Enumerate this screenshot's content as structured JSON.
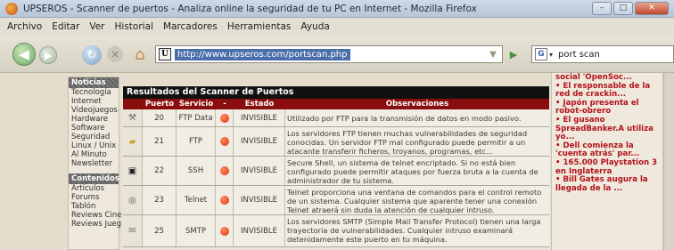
{
  "window": {
    "title": "UPSEROS - Scanner de puertos - Analiza online la seguridad de tu PC en Internet - Mozilla Firefox",
    "controls": [
      "–",
      "□",
      "✕"
    ]
  },
  "menu": [
    "Archivo",
    "Editar",
    "Ver",
    "Historial",
    "Marcadores",
    "Herramientas",
    "Ayuda"
  ],
  "toolbar": {
    "url": "http://www.upseros.com/portscan.php",
    "site_icon": "U",
    "search_engine_icon": "G",
    "search_text": "port scan"
  },
  "sidebar": {
    "sections": [
      {
        "heading": "Noticias",
        "items": [
          "Tecnología",
          "Internet",
          "Videojuegos",
          "Hardware",
          "Software",
          "Seguridad",
          "Linux / Unix",
          "Al Minuto",
          "Newsletter"
        ]
      },
      {
        "heading": "Contenidos",
        "items": [
          "Artículos",
          "Forums",
          "Tablón",
          "Reviews Cine",
          "Reviews Juegos"
        ]
      }
    ]
  },
  "results": {
    "title": "Resultados del Scanner de Puertos",
    "columns": [
      "",
      "Puerto",
      "Servicio",
      "-",
      "Estado",
      "Observaciones"
    ],
    "rows": [
      {
        "icon": "tool-icon",
        "port": "20",
        "service": "FTP Data",
        "status": "INVISIBLE",
        "notes": "Utilizado por FTP para la transmisión de datos en modo pasivo."
      },
      {
        "icon": "folder-icon",
        "port": "21",
        "service": "FTP",
        "status": "INVISIBLE",
        "notes": "Los servidores FTP tienen muchas vulnerabilidades de seguridad conocidas. Un servidor FTP mal configurado puede permitir a un atacante transferir ficheros, troyanos, programas, etc..."
      },
      {
        "icon": "terminal-icon",
        "port": "22",
        "service": "SSH",
        "status": "INVISIBLE",
        "notes": "Secure Shell, un sistema de telnet encriptado. Si no está bien configurado puede permitir ataques por fuerza bruta a la cuenta de administrador de tu sistema."
      },
      {
        "icon": "network-icon",
        "port": "23",
        "service": "Telnet",
        "status": "INVISIBLE",
        "notes": "Telnet proporciona una ventana de comandos para el control remoto de un sistema. Cualquier sistema que aparente tener una conexión Telnet atraerá sin duda la atención de cualquier intruso."
      },
      {
        "icon": "mail-icon",
        "port": "25",
        "service": "SMTP",
        "status": "INVISIBLE",
        "notes": "Los servidores SMTP (Simple Mail Transfer Protocol) tienen una larga trayectoria de vulnerabilidades. Cualquier intruso examinará detenidamente este puerto en tu máquina."
      }
    ]
  },
  "news": [
    {
      "text": "social 'OpenSoc...",
      "bullet": false
    },
    {
      "text": "El responsable de la red de crackin...",
      "bullet": true
    },
    {
      "text": "Japón presenta el robot-obrero",
      "bullet": true
    },
    {
      "text": "El gusano SpreadBanker.A utiliza yo...",
      "bullet": true
    },
    {
      "text": "Dell comienza la 'cuenta atrás' par...",
      "bullet": true
    },
    {
      "text": "165.000 Playstation 3 en Inglaterra",
      "bullet": true
    },
    {
      "text": "Bill Gates augura la llegada de la ...",
      "bullet": true
    }
  ],
  "colors": {
    "header_red": "#8a0d0d",
    "title_black": "#111111",
    "status_dot": "#e0301a",
    "news_red": "#b3121b"
  }
}
